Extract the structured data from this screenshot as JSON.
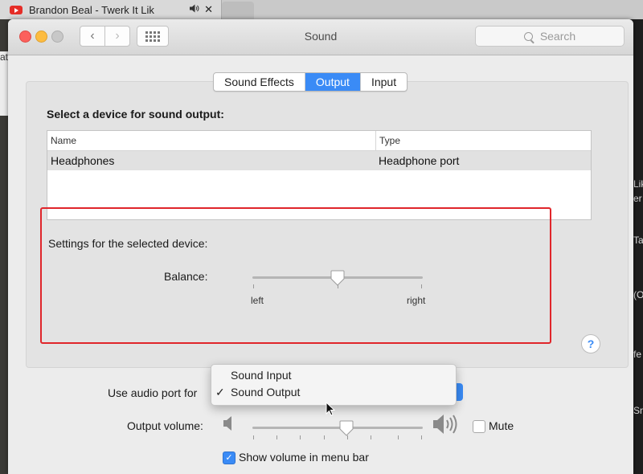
{
  "browser": {
    "tab_title": "Brandon Beal - Twerk It Lik",
    "audio_icon": "speaker-icon",
    "close_glyph": "✕"
  },
  "background": {
    "left_fragment": "at",
    "right_fragments": [
      "Lik",
      "er",
      "Ta",
      "(O",
      "fe",
      "Sn"
    ]
  },
  "window": {
    "title": "Sound",
    "search_placeholder": "Search",
    "back_glyph": "‹",
    "forward_glyph": "›"
  },
  "tabs": [
    {
      "label": "Sound Effects",
      "active": false
    },
    {
      "label": "Output",
      "active": true
    },
    {
      "label": "Input",
      "active": false
    }
  ],
  "output": {
    "heading": "Select a device for sound output:",
    "columns": [
      "Name",
      "Type"
    ],
    "rows": [
      {
        "name": "Headphones",
        "type": "Headphone port",
        "selected": true
      }
    ],
    "settings_heading": "Settings for the selected device:",
    "balance_label": "Balance:",
    "balance_left": "left",
    "balance_right": "right",
    "balance_value": 0.5,
    "help": "?"
  },
  "audio_port": {
    "label": "Use audio port for",
    "options": [
      {
        "label": "Sound Input",
        "checked": false
      },
      {
        "label": "Sound Output",
        "checked": true
      }
    ],
    "check_glyph": "✓"
  },
  "volume": {
    "label": "Output volume:",
    "value": 0.55,
    "mute_label": "Mute",
    "mute_checked": false,
    "menu_bar_label": "Show volume in menu bar",
    "menu_bar_checked": true,
    "check_glyph": "✓"
  },
  "colors": {
    "accent": "#3a8bf6",
    "highlight_box": "#e0262b"
  }
}
